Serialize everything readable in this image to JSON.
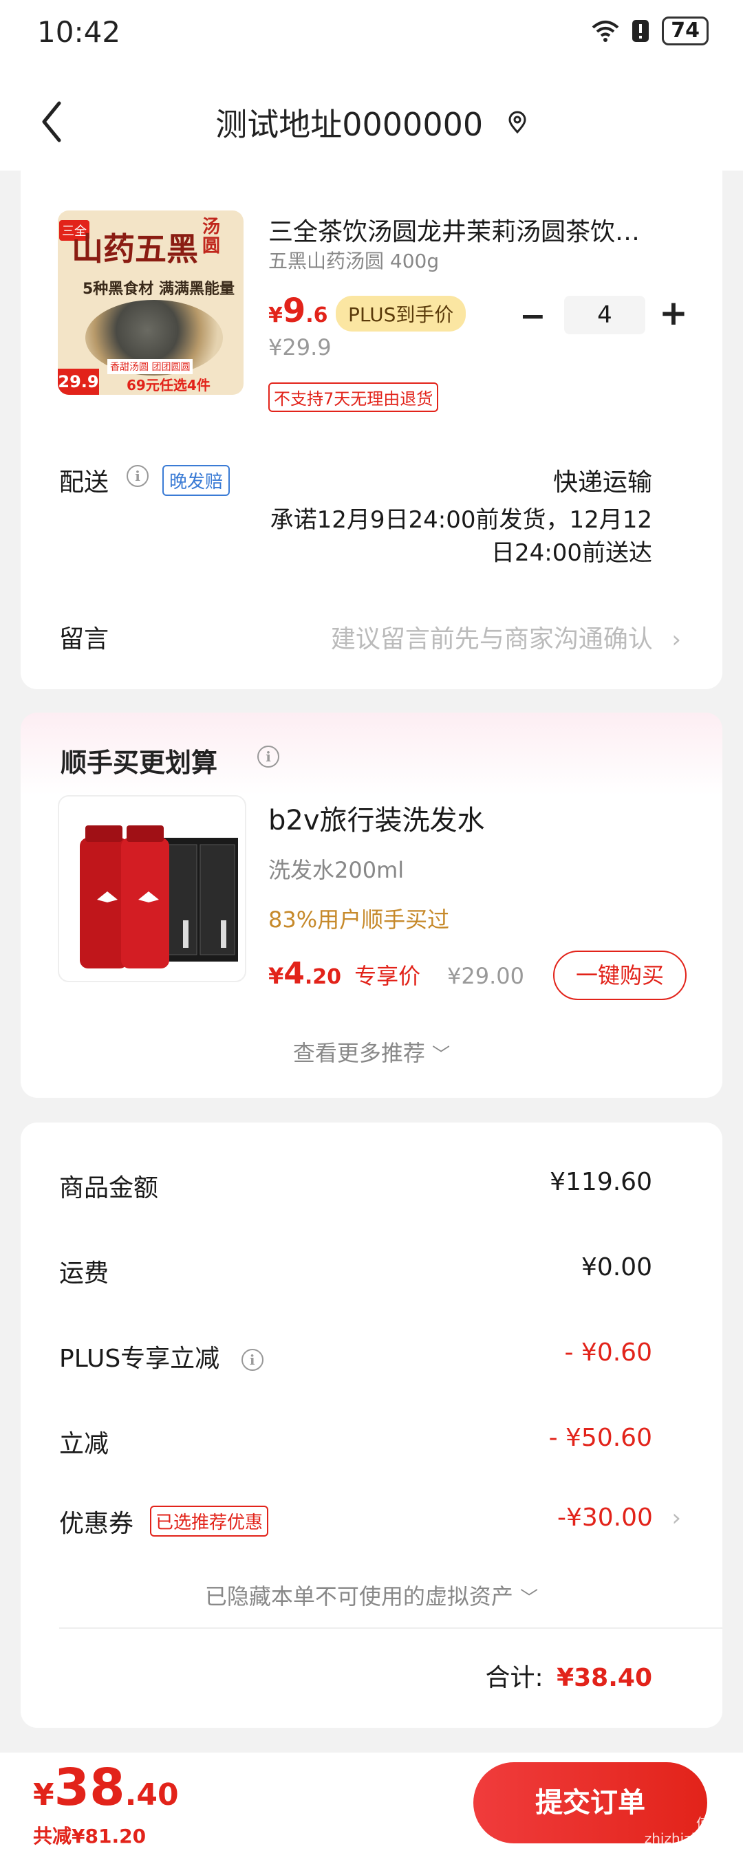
{
  "status_bar": {
    "time": "10:42",
    "battery": "74"
  },
  "header": {
    "address": "测试地址0000000"
  },
  "product": {
    "title": "三全茶饮汤圆龙井茉莉汤圆茶饮…",
    "spec": "五黑山药汤圆 400g",
    "price_symbol": "¥",
    "price_int": "9",
    "price_dec": ".6",
    "plus_tag": "PLUS到手价",
    "original_price": "¥29.9",
    "no_return": "不支持7天无理由退货",
    "quantity": "4",
    "thumb": {
      "brand": "三全",
      "name": "山药五黑",
      "name2": "汤圆",
      "slogan": "5种黑食材 满满黑能量",
      "price_badge": "29.9",
      "promo": "69元任选4件",
      "tags": "香甜汤圆 团团圆圆"
    }
  },
  "delivery": {
    "label": "配送",
    "tag": "晚发赔",
    "method": "快递运输",
    "promise_line1": "承诺12月9日24:00前发货，12月12",
    "promise_line2": "日24:00前送达"
  },
  "message": {
    "label": "留言",
    "placeholder": "建议留言前先与商家沟通确认"
  },
  "addon": {
    "title": "顺手买更划算",
    "product_title": "b2v旅行装洗发水",
    "product_spec": "洗发水200ml",
    "social_proof": "83%用户顺手买过",
    "price_symbol": "¥",
    "price_int": "4",
    "price_dec": ".20",
    "price_label": "专享价",
    "original_price": "¥29.00",
    "buy_button": "一键购买",
    "more": "查看更多推荐"
  },
  "summary": {
    "rows": [
      {
        "label": "商品金额",
        "value": "¥119.60"
      },
      {
        "label": "运费",
        "value": "¥0.00"
      },
      {
        "label": "PLUS专享立减",
        "value": "- ¥0.60"
      },
      {
        "label": "立减",
        "value": "- ¥50.60"
      },
      {
        "label": "优惠券",
        "value": "-¥30.00",
        "tag": "已选推荐优惠"
      }
    ],
    "hidden_note": "已隐藏本单不可使用的虚拟资产",
    "total_label": "合计:",
    "total_value": "¥38.40"
  },
  "bottom": {
    "price_symbol": "¥",
    "price_int": "38",
    "price_dec": ".40",
    "saved": "共减¥81.20",
    "submit": "提交订单"
  },
  "watermark": "值值值 zhizhizhi.com",
  "colors": {
    "accent": "#e2231a",
    "plus_tag_bg": "#fbe6a2",
    "social_proof": "#c6892a",
    "late_tag": "#3a7bd5"
  }
}
